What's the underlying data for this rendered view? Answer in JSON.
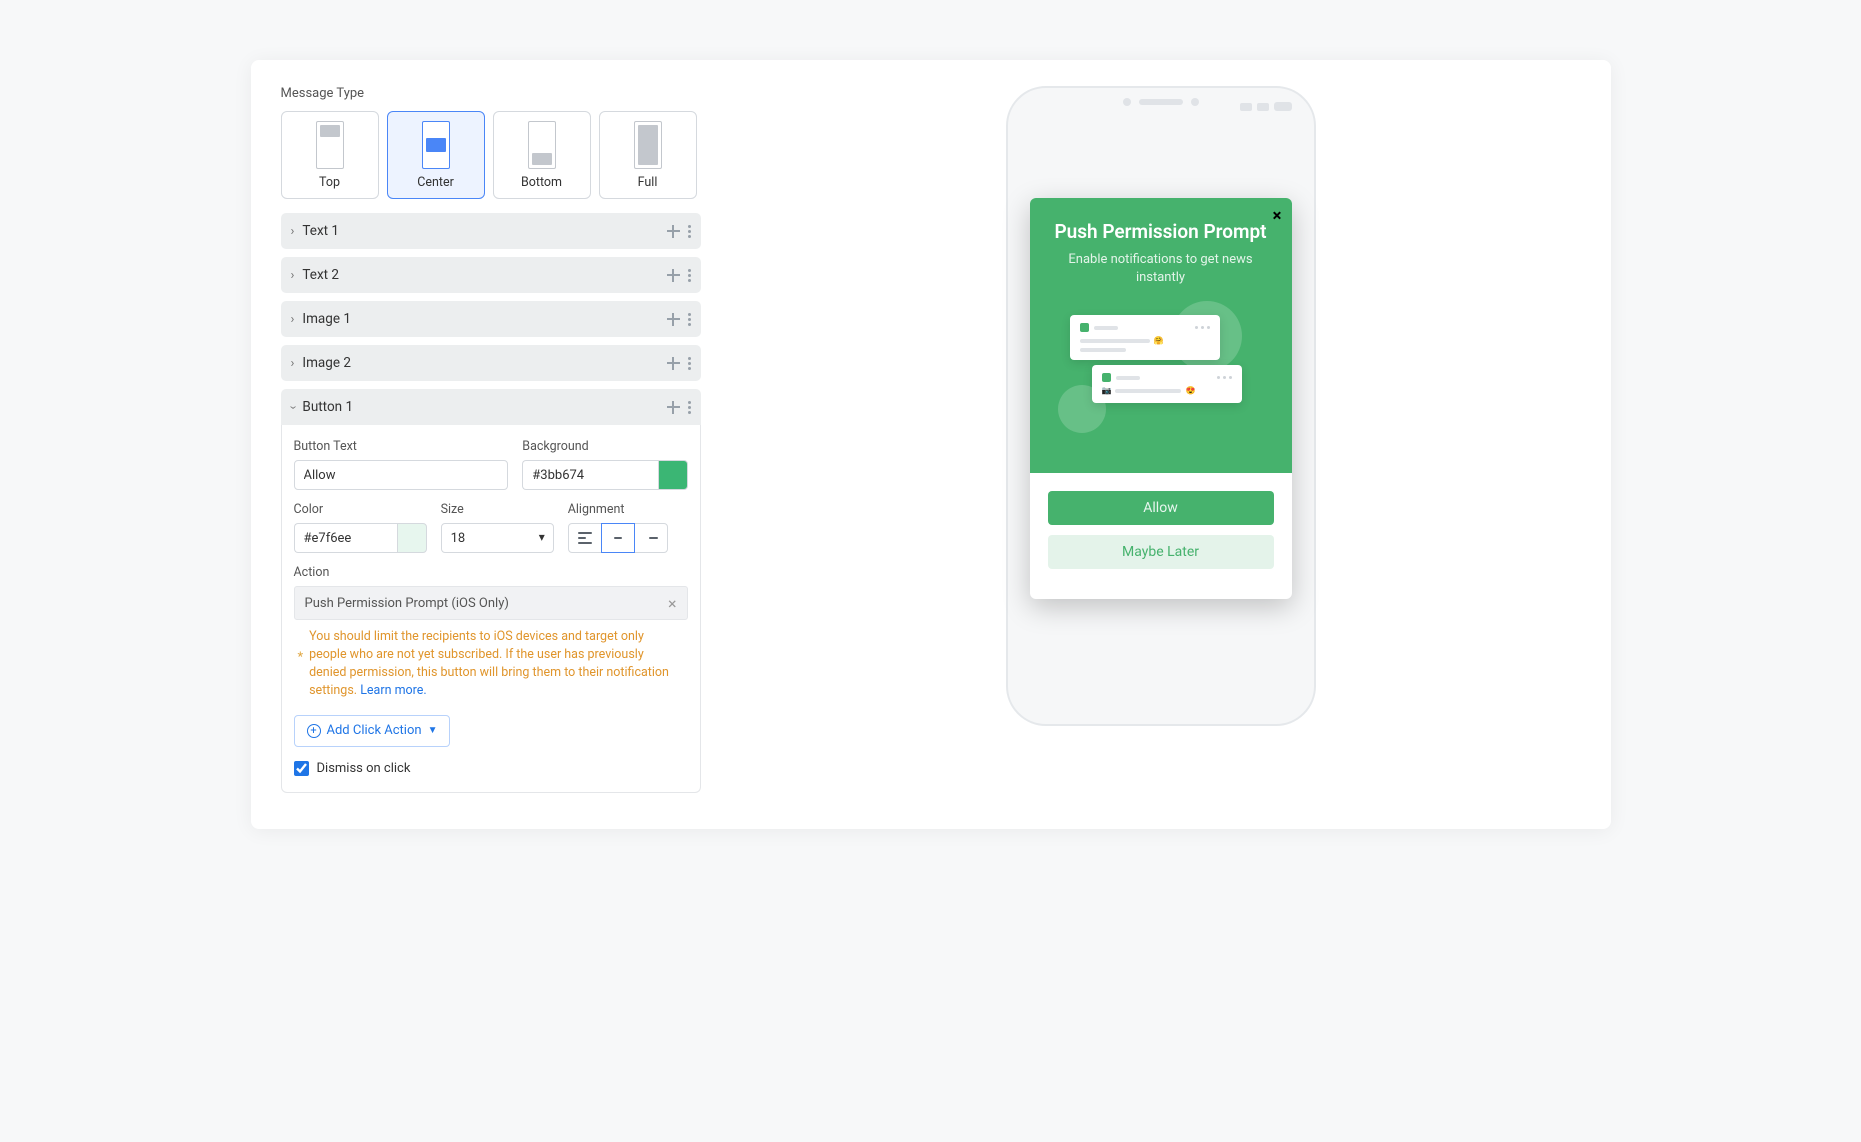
{
  "section_label": "Message Type",
  "msgtypes": {
    "top": "Top",
    "center": "Center",
    "bottom": "Bottom",
    "full": "Full"
  },
  "accordions": {
    "text1": "Text 1",
    "text2": "Text 2",
    "image1": "Image 1",
    "image2": "Image 2",
    "button1": "Button 1"
  },
  "button1_form": {
    "button_text_label": "Button Text",
    "button_text_value": "Allow",
    "background_label": "Background",
    "background_value": "#3bb674",
    "color_label": "Color",
    "color_value": "#e7f6ee",
    "size_label": "Size",
    "size_value": "18",
    "alignment_label": "Alignment",
    "action_label": "Action",
    "action_value": "Push Permission Prompt (iOS Only)",
    "warning_text": "You should limit the recipients to iOS devices and target only people who are not yet subscribed. If the user has previously denied permission, this button will bring them to their notification settings. ",
    "warning_link": "Learn more.",
    "add_click_label": "Add Click Action",
    "dismiss_label": "Dismiss on click"
  },
  "preview": {
    "title": "Push Permission Prompt",
    "subtitle": "Enable notifications to get news instantly",
    "allow_btn": "Allow",
    "later_btn": "Maybe Later"
  },
  "colors": {
    "primary": "#46b26d",
    "secondary_bg": "#e4f3ea"
  }
}
